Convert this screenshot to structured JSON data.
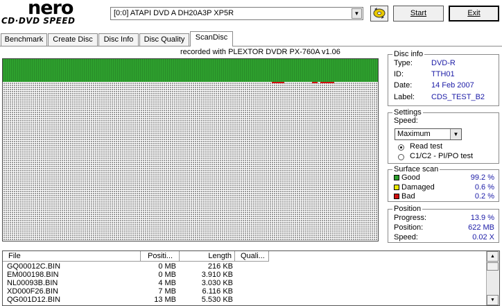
{
  "logo": {
    "brand": "nero",
    "product": "CD·DVD SPEED"
  },
  "toolbar": {
    "drive": "[0:0]  ATAPI DVD A  DH20A3P XP5R",
    "start_label": "Start",
    "exit_label": "Exit"
  },
  "tabs": [
    {
      "label": "Benchmark"
    },
    {
      "label": "Create Disc"
    },
    {
      "label": "Disc Info"
    },
    {
      "label": "Disc Quality"
    },
    {
      "label": "ScanDisc",
      "active": true
    }
  ],
  "recorded": "recorded with PLEXTOR DVDR   PX-760A    v1.06",
  "scan": {
    "good_fraction": 0.139,
    "colors": {
      "good": "#2ea02e",
      "bad": "#d01010",
      "unscanned": "#9a9a9a"
    }
  },
  "disc_info": {
    "title": "Disc info",
    "rows": [
      {
        "label": "Type:",
        "value": "DVD-R"
      },
      {
        "label": "ID:",
        "value": "TTH01"
      },
      {
        "label": "Date:",
        "value": "14 Feb 2007"
      },
      {
        "label": "Label:",
        "value": "CDS_TEST_B2"
      }
    ]
  },
  "settings": {
    "title": "Settings",
    "speed_label": "Speed:",
    "speed_value": "Maximum",
    "read_test": "Read test",
    "c1c2_test": "C1/C2 - PI/PO test"
  },
  "surface": {
    "title": "Surface scan",
    "rows": [
      {
        "label": "Good",
        "value": "99.2 %",
        "color": "#2ea02e"
      },
      {
        "label": "Damaged",
        "value": "0.6 %",
        "color": "#e8e800"
      },
      {
        "label": "Bad",
        "value": "0.2 %",
        "color": "#d01010"
      }
    ]
  },
  "position": {
    "title": "Position",
    "rows": [
      {
        "label": "Progress:",
        "value": "13.9 %"
      },
      {
        "label": "Position:",
        "value": "622 MB"
      },
      {
        "label": "Speed:",
        "value": "0.02 X"
      }
    ]
  },
  "file_list": {
    "columns": [
      "File",
      "Positi...",
      "Length",
      "Quali..."
    ],
    "rows": [
      {
        "file": "GQ00012C.BIN",
        "position": "0 MB",
        "length": "216 KB"
      },
      {
        "file": "EM000198.BIN",
        "position": "0 MB",
        "length": "3.910 KB"
      },
      {
        "file": "NL00093B.BIN",
        "position": "4 MB",
        "length": "3.030 KB"
      },
      {
        "file": "XD000F26.BIN",
        "position": "7 MB",
        "length": "6.116 KB"
      },
      {
        "file": "QG001D12.BIN",
        "position": "13 MB",
        "length": "5.530 KB"
      }
    ]
  }
}
